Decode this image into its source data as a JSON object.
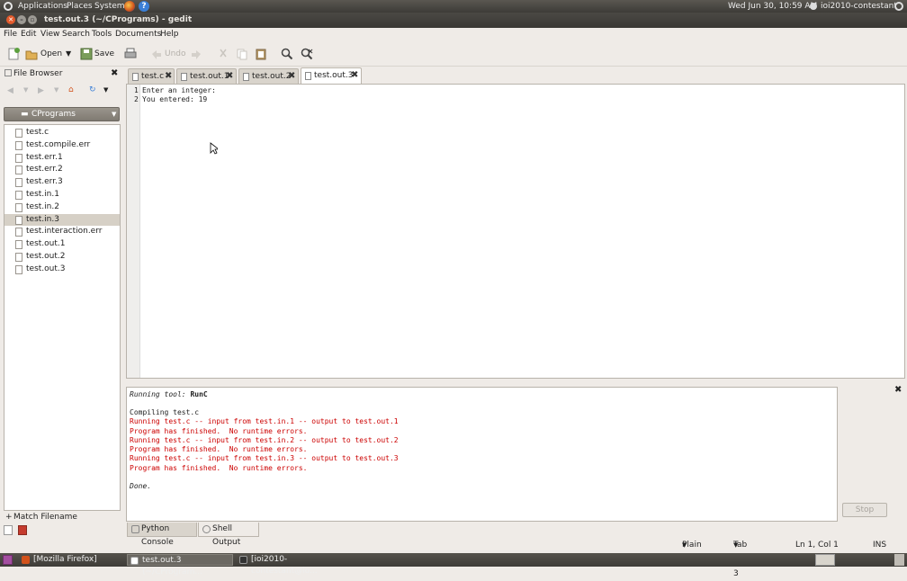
{
  "top_panel": {
    "menus": [
      "Applications",
      "Places",
      "System"
    ],
    "clock": "Wed Jun 30, 10:59 AM",
    "user": "ioi2010-contestant"
  },
  "window": {
    "title": "test.out.3 (~/CPrograms) - gedit"
  },
  "menubar": [
    "File",
    "Edit",
    "View",
    "Search",
    "Tools",
    "Documents",
    "Help"
  ],
  "toolbar": {
    "open": "Open",
    "save": "Save",
    "undo": "Undo"
  },
  "file_browser": {
    "title": "File Browser",
    "location": "CPrograms",
    "files": [
      "test.c",
      "test.compile.err",
      "test.err.1",
      "test.err.2",
      "test.err.3",
      "test.in.1",
      "test.in.2",
      "test.in.3",
      "test.interaction.err",
      "test.out.1",
      "test.out.2",
      "test.out.3"
    ],
    "selected": "test.in.3",
    "filter_label": "Match Filename"
  },
  "tabs": [
    "test.c",
    "test.out.1",
    "test.out.2",
    "test.out.3"
  ],
  "active_tab": "test.out.3",
  "editor": {
    "line_numbers": [
      "1",
      "2"
    ],
    "lines": [
      "Enter an integer:",
      "You entered: 19"
    ]
  },
  "output": {
    "running_label": "Running tool: ",
    "tool_name": "RunC",
    "lines": [
      {
        "text": "Compiling test.c",
        "style": "normal"
      },
      {
        "text": "Running test.c -- input from test.in.1 -- output to test.out.1",
        "style": "red"
      },
      {
        "text": "Program has finished.  No runtime errors.",
        "style": "red"
      },
      {
        "text": "Running test.c -- input from test.in.2 -- output to test.out.2",
        "style": "red"
      },
      {
        "text": "Program has finished.  No runtime errors.",
        "style": "red"
      },
      {
        "text": "Running test.c -- input from test.in.3 -- output to test.out.3",
        "style": "red"
      },
      {
        "text": "Program has finished.  No runtime errors.",
        "style": "red"
      },
      {
        "text": "Done.",
        "style": "italic"
      }
    ],
    "stop_label": "Stop"
  },
  "bottom_tabs": [
    "Python Console",
    "Shell Output"
  ],
  "statusbar": {
    "lang": "Plain Text",
    "tab_width": "Tab Width:  3",
    "position": "Ln 1, Col 1",
    "mode": "INS"
  },
  "taskbar": {
    "tasks": [
      "[Mozilla Firefox]",
      "test.out.3 (~/CProgram...",
      "[ioi2010-contestant@io..."
    ]
  }
}
